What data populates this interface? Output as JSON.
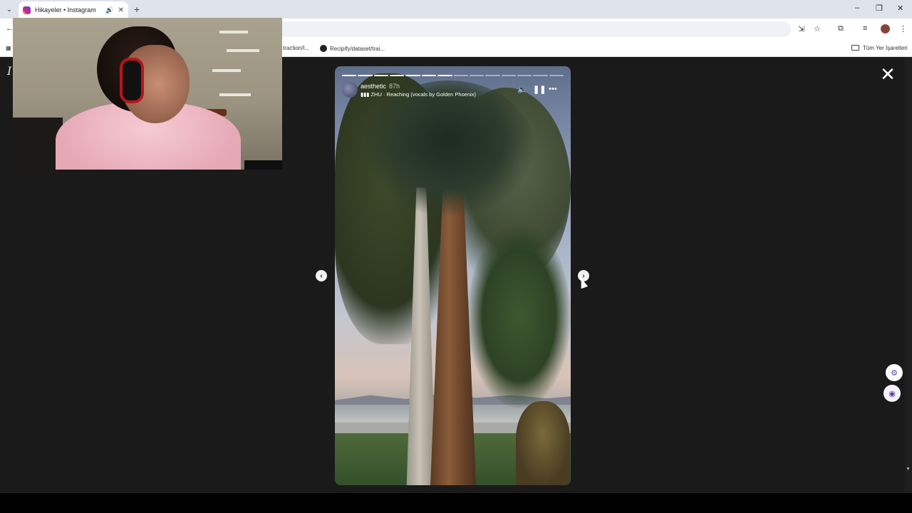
{
  "browser": {
    "tab_title": "Hikayeler • Instagram",
    "tab_sound_icon": "speaker-icon",
    "new_tab_label": "+",
    "window_controls": {
      "minimize": "–",
      "restore": "❐",
      "close": "✕"
    },
    "bookmarks": [
      {
        "label": "traction/l..."
      },
      {
        "label": "Recipify/dataset/trai..."
      }
    ],
    "all_bookmarks_label": "Tüm Yer İşaretleri"
  },
  "story": {
    "username": "aesthetic",
    "time_ago": "87h",
    "music": "ZHU · Reaching (vocals by Golden Phoenix)",
    "segments_total": 14,
    "segments_done": 7
  },
  "page": {
    "close_label": "✕",
    "prev_label": "‹",
    "next_label": "›"
  },
  "colors": {
    "page_bg": "#1a1a1a",
    "chrome_bg": "#dfe3eb"
  }
}
